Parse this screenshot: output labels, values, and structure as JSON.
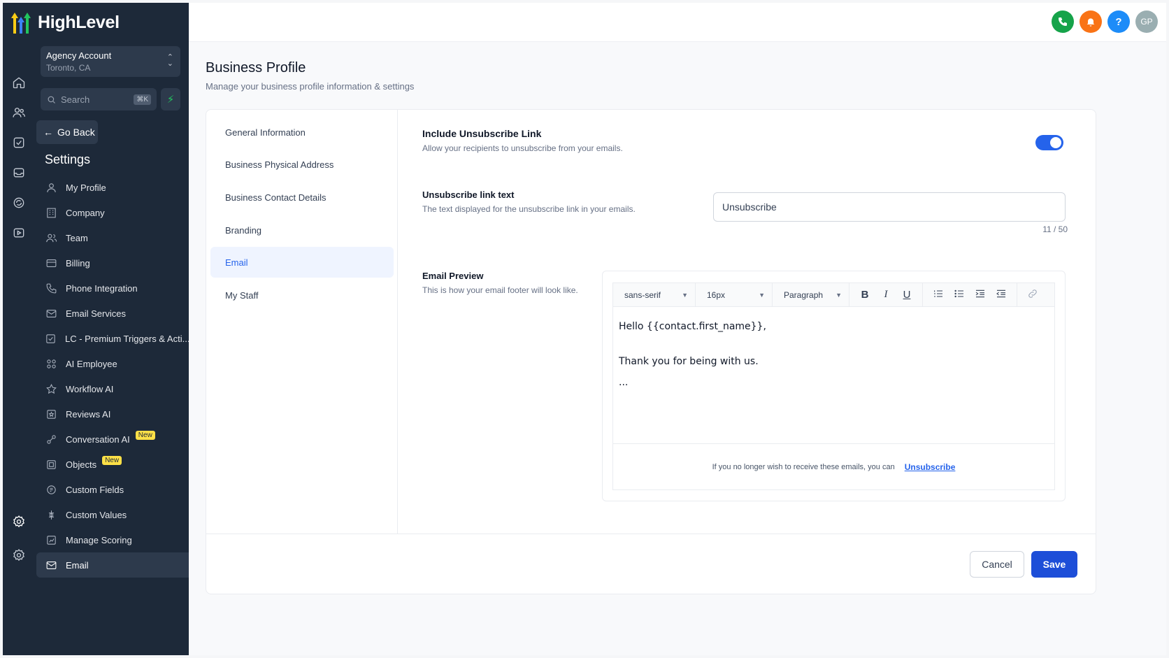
{
  "brand": {
    "name": "HighLevel"
  },
  "account": {
    "name": "Agency Account",
    "location": "Toronto, CA"
  },
  "search": {
    "placeholder": "Search",
    "shortcut": "⌘K"
  },
  "sidebar": {
    "go_back": "Go Back",
    "title": "Settings",
    "items": [
      {
        "label": "My Profile",
        "icon": "user-icon"
      },
      {
        "label": "Company",
        "icon": "building-icon"
      },
      {
        "label": "Team",
        "icon": "team-icon"
      },
      {
        "label": "Billing",
        "icon": "billing-icon"
      },
      {
        "label": "Phone Integration",
        "icon": "phone-icon"
      },
      {
        "label": "Email Services",
        "icon": "mail-icon"
      },
      {
        "label": "LC - Premium Triggers & Acti...",
        "icon": "trigger-icon"
      },
      {
        "label": "AI Employee",
        "icon": "ai-employee-icon"
      },
      {
        "label": "Workflow AI",
        "icon": "star-icon"
      },
      {
        "label": "Reviews AI",
        "icon": "reviews-icon"
      },
      {
        "label": "Conversation AI",
        "icon": "conversation-icon",
        "badge": "New"
      },
      {
        "label": "Objects",
        "icon": "objects-icon",
        "badge": "New"
      },
      {
        "label": "Custom Fields",
        "icon": "custom-fields-icon"
      },
      {
        "label": "Custom Values",
        "icon": "custom-values-icon"
      },
      {
        "label": "Manage Scoring",
        "icon": "scoring-icon"
      },
      {
        "label": "Email",
        "icon": "mail-icon"
      }
    ]
  },
  "topbar": {
    "avatar_initials": "GP",
    "help": "?"
  },
  "page": {
    "title": "Business Profile",
    "subtitle": "Manage your business profile information & settings"
  },
  "subnav": {
    "items": [
      "General Information",
      "Business Physical Address",
      "Business Contact Details",
      "Branding",
      "Email",
      "My Staff"
    ],
    "active": "Email"
  },
  "unsubscribe": {
    "label": "Include Unsubscribe Link",
    "description": "Allow your recipients to unsubscribe from your emails.",
    "enabled": true,
    "text_label": "Unsubscribe link text",
    "text_description": "The text displayed for the unsubscribe link in your emails.",
    "text_value": "Unsubscribe",
    "counter": "11 / 50"
  },
  "preview": {
    "label": "Email Preview",
    "description": "This is how your email footer will look like.",
    "font": "sans-serif",
    "size": "16px",
    "block": "Paragraph",
    "body": [
      "Hello {{contact.first_name}},",
      "Thank you for being with us.",
      "..."
    ],
    "footer_text": "If you no longer wish to receive these emails, you can",
    "footer_link": "Unsubscribe"
  },
  "actions": {
    "cancel": "Cancel",
    "save": "Save"
  },
  "colors": {
    "accent": "#1d4ed8",
    "sidebar_bg": "#1d2939",
    "phone": "#16a34a",
    "bell": "#f97316",
    "help": "#1d8cf8",
    "avatar": "#9aaeb1",
    "badge": "#fde047"
  }
}
